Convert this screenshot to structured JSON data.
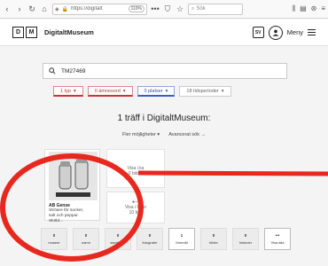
{
  "browser": {
    "url": "https://digitalt",
    "zoom": "110%",
    "search_placeholder": "Sök",
    "menu_overflow": "•••"
  },
  "header": {
    "logo_letters": [
      "D",
      "M"
    ],
    "site_name": "DigitaltMuseum",
    "lang": "SV",
    "menu_label": "Meny"
  },
  "search": {
    "query": "TM27469"
  },
  "filters": [
    {
      "label": "1 typ"
    },
    {
      "label": "0 ämnesord"
    },
    {
      "label": "0 platser"
    },
    {
      "label": "18 tidsperioder"
    }
  ],
  "results": {
    "title": "1 träff i DigitaltMuseum:",
    "more_options": "Fler möjligheter",
    "advanced_search": "Avancerat sök",
    "card": {
      "title": "AB Gense",
      "description": [
        "Ströare för socker,",
        "salt och peppar.",
        "Sköld..."
      ]
    },
    "ghost_1": [
      "Visa i ka",
      "0 bilder"
    ],
    "ghost_2": [
      "Visa i bilde",
      "10 bild"
    ]
  },
  "categories": [
    {
      "count": "0",
      "label": "museer"
    },
    {
      "count": "0",
      "label": "namn"
    },
    {
      "count": "0",
      "label": "samlingar"
    },
    {
      "count": "0",
      "label": "fotografer"
    },
    {
      "count": "1",
      "label": "föremål"
    },
    {
      "count": "0",
      "label": "bilder"
    },
    {
      "count": "0",
      "label": "historier"
    },
    {
      "count": "•••",
      "label": "Visa alla"
    }
  ],
  "annotation_color": "#e8281e"
}
